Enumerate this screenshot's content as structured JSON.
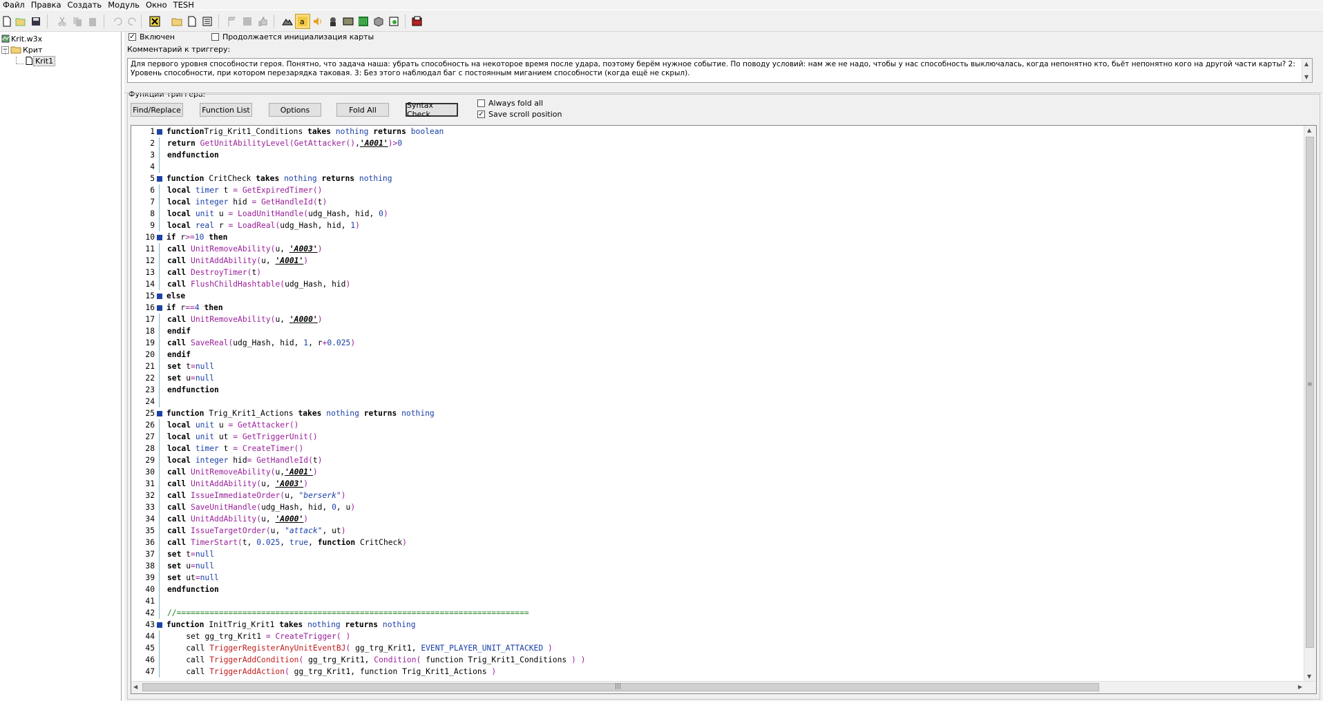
{
  "menu": [
    "Файл",
    "Правка",
    "Создать",
    "Модуль",
    "Окно",
    "TESH"
  ],
  "toolbar_icons": [
    "new-icon",
    "open-icon",
    "save-icon",
    "cut-icon",
    "copy-icon",
    "paste-icon",
    "undo-icon",
    "redo-icon",
    "delete-icon",
    "folder-icon",
    "page-icon",
    "list-icon",
    "flag-icon",
    "disk-icon",
    "thumb-icon",
    "terrain-icon",
    "letter-a-icon",
    "sound-icon",
    "unit-icon",
    "map-icon",
    "matrix-icon",
    "box-icon",
    "import-icon",
    "test-map-icon"
  ],
  "tree": {
    "root": "Krit.w3x",
    "category": "Крит",
    "trigger": "Krit1"
  },
  "panel": {
    "enabled_label": "Включен",
    "enabled_checked": true,
    "init_label": "Продолжается инициализация карты",
    "init_checked": false,
    "comment_label": "Комментарий к триггеру:",
    "comment_text": "Для первого уровня способности героя. Понятно, что задача наша: убрать способность на некоторое время после удара, поэтому берём нужное событие. По поводу условий: нам же не надо, чтобы у нас способность выключалась, когда непонятно кто, бьёт непонятно кого на другой части карты? 2: Уровень способности, при котором перезарядка таковая. 3: Без этого наблюдал баг с постоянным миганием способности (когда ещё не скрыл).",
    "functions_label": "Функции триггера:",
    "buttons": {
      "find_replace": "Find/Replace",
      "function_list": "Function List",
      "options": "Options",
      "fold_all": "Fold All",
      "syntax_check": "Syntax Check"
    },
    "always_fold_label": "Always fold all",
    "always_fold_checked": false,
    "save_scroll_label": "Save scroll position",
    "save_scroll_checked": true
  },
  "colors": {
    "fold_marker": "#1c43a6",
    "keyword_type": "#1a3fa8",
    "native_function": "#9a1e9a",
    "bj_function": "#c11b1b"
  },
  "code_lines": [
    {
      "n": 1,
      "fold": true,
      "tokens": [
        [
          "kw",
          "function"
        ],
        [
          "",
          "Trig_Krit1_Conditions "
        ],
        [
          "kw",
          "takes"
        ],
        [
          "",
          ""
        ],
        [
          "ty",
          " nothing"
        ],
        [
          "",
          ""
        ],
        [
          "kw",
          " returns"
        ],
        [
          "ty",
          " boolean"
        ]
      ]
    },
    {
      "n": 2,
      "tokens": [
        [
          "kw",
          "return"
        ],
        [
          "fn",
          " GetUnitAbilityLevel"
        ],
        [
          "op",
          "("
        ],
        [
          "fn",
          "GetAttacker"
        ],
        [
          "op",
          "()"
        ],
        [
          "",
          ","
        ],
        [
          "raw",
          "'A001'"
        ],
        [
          "op",
          ")>"
        ],
        [
          "num",
          "0"
        ]
      ]
    },
    {
      "n": 3,
      "tokens": [
        [
          "kw",
          "endfunction"
        ]
      ]
    },
    {
      "n": 4,
      "tokens": []
    },
    {
      "n": 5,
      "fold": true,
      "tokens": [
        [
          "kw",
          "function"
        ],
        [
          "",
          " CritCheck "
        ],
        [
          "kw",
          "takes"
        ],
        [
          "ty",
          " nothing"
        ],
        [
          "kw",
          " returns"
        ],
        [
          "ty",
          " nothing"
        ]
      ]
    },
    {
      "n": 6,
      "tokens": [
        [
          "kw",
          "local"
        ],
        [
          "ty",
          " timer"
        ],
        [
          "",
          " t "
        ],
        [
          "op",
          "="
        ],
        [
          "fn",
          " GetExpiredTimer"
        ],
        [
          "op",
          "()"
        ]
      ]
    },
    {
      "n": 7,
      "tokens": [
        [
          "kw",
          "local"
        ],
        [
          "ty",
          " integer"
        ],
        [
          "",
          " hid "
        ],
        [
          "op",
          "="
        ],
        [
          "fn",
          " GetHandleId"
        ],
        [
          "op",
          "("
        ],
        [
          "",
          "t"
        ],
        [
          "op",
          ")"
        ]
      ]
    },
    {
      "n": 8,
      "tokens": [
        [
          "kw",
          "local"
        ],
        [
          "ty",
          " unit"
        ],
        [
          "",
          " u "
        ],
        [
          "op",
          "="
        ],
        [
          "fn",
          " LoadUnitHandle"
        ],
        [
          "op",
          "("
        ],
        [
          "",
          "udg_Hash, hid, "
        ],
        [
          "num",
          "0"
        ],
        [
          "op",
          ")"
        ]
      ]
    },
    {
      "n": 9,
      "tokens": [
        [
          "kw",
          "local"
        ],
        [
          "ty",
          " real"
        ],
        [
          "",
          " r "
        ],
        [
          "op",
          "="
        ],
        [
          "fn",
          " LoadReal"
        ],
        [
          "op",
          "("
        ],
        [
          "",
          "udg_Hash, hid, "
        ],
        [
          "num",
          "1"
        ],
        [
          "op",
          ")"
        ]
      ]
    },
    {
      "n": 10,
      "fold": true,
      "tokens": [
        [
          "kw",
          "if"
        ],
        [
          "",
          " r"
        ],
        [
          "op",
          ">="
        ],
        [
          "num",
          "10"
        ],
        [
          "kw",
          " then"
        ]
      ]
    },
    {
      "n": 11,
      "tokens": [
        [
          "kw",
          "call"
        ],
        [
          "fn",
          " UnitRemoveAbility"
        ],
        [
          "op",
          "("
        ],
        [
          "",
          "u, "
        ],
        [
          "raw",
          "'A003'"
        ],
        [
          "op",
          ")"
        ]
      ]
    },
    {
      "n": 12,
      "tokens": [
        [
          "kw",
          "call"
        ],
        [
          "fn",
          " UnitAddAbility"
        ],
        [
          "op",
          "("
        ],
        [
          "",
          "u, "
        ],
        [
          "raw",
          "'A001'"
        ],
        [
          "op",
          ")"
        ]
      ]
    },
    {
      "n": 13,
      "tokens": [
        [
          "kw",
          "call"
        ],
        [
          "fn",
          " DestroyTimer"
        ],
        [
          "op",
          "("
        ],
        [
          "",
          "t"
        ],
        [
          "op",
          ")"
        ]
      ]
    },
    {
      "n": 14,
      "tokens": [
        [
          "kw",
          "call"
        ],
        [
          "fn",
          " FlushChildHashtable"
        ],
        [
          "op",
          "("
        ],
        [
          "",
          "udg_Hash, hid"
        ],
        [
          "op",
          ")"
        ]
      ]
    },
    {
      "n": 15,
      "fold": true,
      "tokens": [
        [
          "kw",
          "else"
        ]
      ]
    },
    {
      "n": 16,
      "fold": true,
      "tokens": [
        [
          "kw",
          "if"
        ],
        [
          "",
          " r"
        ],
        [
          "op",
          "=="
        ],
        [
          "num",
          "4"
        ],
        [
          "kw",
          " then"
        ]
      ]
    },
    {
      "n": 17,
      "tokens": [
        [
          "kw",
          "call"
        ],
        [
          "fn",
          " UnitRemoveAbility"
        ],
        [
          "op",
          "("
        ],
        [
          "",
          "u, "
        ],
        [
          "raw",
          "'A000'"
        ],
        [
          "op",
          ")"
        ]
      ]
    },
    {
      "n": 18,
      "tokens": [
        [
          "kw",
          "endif"
        ]
      ]
    },
    {
      "n": 19,
      "tokens": [
        [
          "kw",
          "call"
        ],
        [
          "fn",
          " SaveReal"
        ],
        [
          "op",
          "("
        ],
        [
          "",
          "udg_Hash, hid, "
        ],
        [
          "num",
          "1"
        ],
        [
          "",
          ", r"
        ],
        [
          "op",
          "+"
        ],
        [
          "num",
          "0.025"
        ],
        [
          "op",
          ")"
        ]
      ]
    },
    {
      "n": 20,
      "tokens": [
        [
          "kw",
          "endif"
        ]
      ]
    },
    {
      "n": 21,
      "tokens": [
        [
          "kw",
          "set"
        ],
        [
          "",
          " t"
        ],
        [
          "op",
          "="
        ],
        [
          "ty",
          "null"
        ]
      ]
    },
    {
      "n": 22,
      "tokens": [
        [
          "kw",
          "set"
        ],
        [
          "",
          " u"
        ],
        [
          "op",
          "="
        ],
        [
          "ty",
          "null"
        ]
      ]
    },
    {
      "n": 23,
      "tokens": [
        [
          "kw",
          "endfunction"
        ]
      ]
    },
    {
      "n": 24,
      "tokens": []
    },
    {
      "n": 25,
      "fold": true,
      "tokens": [
        [
          "kw",
          "function"
        ],
        [
          "",
          " Trig_Krit1_Actions "
        ],
        [
          "kw",
          "takes"
        ],
        [
          "ty",
          " nothing"
        ],
        [
          "kw",
          " returns"
        ],
        [
          "ty",
          " nothing"
        ]
      ]
    },
    {
      "n": 26,
      "tokens": [
        [
          "kw",
          "local"
        ],
        [
          "ty",
          " unit"
        ],
        [
          "",
          " u "
        ],
        [
          "op",
          "="
        ],
        [
          "fn",
          " GetAttacker"
        ],
        [
          "op",
          "()"
        ]
      ]
    },
    {
      "n": 27,
      "tokens": [
        [
          "kw",
          "local"
        ],
        [
          "ty",
          " unit"
        ],
        [
          "",
          " ut "
        ],
        [
          "op",
          "="
        ],
        [
          "fn",
          " GetTriggerUnit"
        ],
        [
          "op",
          "()"
        ]
      ]
    },
    {
      "n": 28,
      "tokens": [
        [
          "kw",
          "local"
        ],
        [
          "ty",
          " timer"
        ],
        [
          "",
          " t "
        ],
        [
          "op",
          "="
        ],
        [
          "fn",
          " CreateTimer"
        ],
        [
          "op",
          "()"
        ]
      ]
    },
    {
      "n": 29,
      "tokens": [
        [
          "kw",
          "local"
        ],
        [
          "ty",
          " integer"
        ],
        [
          "",
          " hid"
        ],
        [
          "op",
          "="
        ],
        [
          "fn",
          " GetHandleId"
        ],
        [
          "op",
          "("
        ],
        [
          "",
          "t"
        ],
        [
          "op",
          ")"
        ]
      ]
    },
    {
      "n": 30,
      "tokens": [
        [
          "kw",
          "call"
        ],
        [
          "fn",
          " UnitRemoveAbility"
        ],
        [
          "op",
          "("
        ],
        [
          "",
          "u,"
        ],
        [
          "raw",
          "'A001'"
        ],
        [
          "op",
          ")"
        ]
      ]
    },
    {
      "n": 31,
      "tokens": [
        [
          "kw",
          "call"
        ],
        [
          "fn",
          " UnitAddAbility"
        ],
        [
          "op",
          "("
        ],
        [
          "",
          "u, "
        ],
        [
          "raw",
          "'A003'"
        ],
        [
          "op",
          ")"
        ]
      ]
    },
    {
      "n": 32,
      "tokens": [
        [
          "kw",
          "call"
        ],
        [
          "fn",
          " IssueImmediateOrder"
        ],
        [
          "op",
          "("
        ],
        [
          "",
          "u, "
        ],
        [
          "str",
          "\"berserk\""
        ],
        [
          "op",
          ")"
        ]
      ]
    },
    {
      "n": 33,
      "tokens": [
        [
          "kw",
          "call"
        ],
        [
          "fn",
          " SaveUnitHandle"
        ],
        [
          "op",
          "("
        ],
        [
          "",
          "udg_Hash, hid, "
        ],
        [
          "num",
          "0"
        ],
        [
          "",
          ", u"
        ],
        [
          "op",
          ")"
        ]
      ]
    },
    {
      "n": 34,
      "tokens": [
        [
          "kw",
          "call"
        ],
        [
          "fn",
          " UnitAddAbility"
        ],
        [
          "op",
          "("
        ],
        [
          "",
          "u, "
        ],
        [
          "raw",
          "'A000'"
        ],
        [
          "op",
          ")"
        ]
      ]
    },
    {
      "n": 35,
      "tokens": [
        [
          "kw",
          "call"
        ],
        [
          "fn",
          " IssueTargetOrder"
        ],
        [
          "op",
          "("
        ],
        [
          "",
          "u, "
        ],
        [
          "str",
          "\"attack\""
        ],
        [
          "",
          ", ut"
        ],
        [
          "op",
          ")"
        ]
      ]
    },
    {
      "n": 36,
      "tokens": [
        [
          "kw",
          "call"
        ],
        [
          "fn",
          " TimerStart"
        ],
        [
          "op",
          "("
        ],
        [
          "",
          "t, "
        ],
        [
          "num",
          "0.025"
        ],
        [
          "",
          ", "
        ],
        [
          "ty",
          "true"
        ],
        [
          "",
          ", "
        ],
        [
          "kw",
          "function"
        ],
        [
          "",
          " CritCheck"
        ],
        [
          "op",
          ")"
        ]
      ]
    },
    {
      "n": 37,
      "tokens": [
        [
          "kw",
          "set"
        ],
        [
          "",
          " t"
        ],
        [
          "op",
          "="
        ],
        [
          "ty",
          "null"
        ]
      ]
    },
    {
      "n": 38,
      "tokens": [
        [
          "kw",
          "set"
        ],
        [
          "",
          " u"
        ],
        [
          "op",
          "="
        ],
        [
          "ty",
          "null"
        ]
      ]
    },
    {
      "n": 39,
      "tokens": [
        [
          "kw",
          "set"
        ],
        [
          "",
          " ut"
        ],
        [
          "op",
          "="
        ],
        [
          "ty",
          "null"
        ]
      ]
    },
    {
      "n": 40,
      "tokens": [
        [
          "kw",
          "endfunction"
        ]
      ]
    },
    {
      "n": 41,
      "tokens": []
    },
    {
      "n": 42,
      "tokens": [
        [
          "cmt",
          "//==========================================================================="
        ]
      ]
    },
    {
      "n": 43,
      "fold": true,
      "tokens": [
        [
          "kw",
          "function"
        ],
        [
          "",
          " InitTrig_Krit1 "
        ],
        [
          "kw",
          "takes"
        ],
        [
          "ty",
          " nothing"
        ],
        [
          "kw",
          " returns"
        ],
        [
          "ty",
          " nothing"
        ]
      ]
    },
    {
      "n": 44,
      "tokens": [
        [
          "",
          "    set gg_trg_Krit1 "
        ],
        [
          "op",
          "="
        ],
        [
          "fn",
          " CreateTrigger"
        ],
        [
          "op",
          "( )"
        ]
      ]
    },
    {
      "n": 45,
      "tokens": [
        [
          "",
          "    call "
        ],
        [
          "bfn",
          "TriggerRegisterAnyUnitEventBJ"
        ],
        [
          "op",
          "("
        ],
        [
          "",
          " gg_trg_Krit1, "
        ],
        [
          "cst",
          "EVENT_PLAYER_UNIT_ATTACKED"
        ],
        [
          "op",
          " )"
        ]
      ]
    },
    {
      "n": 46,
      "tokens": [
        [
          "",
          "    call "
        ],
        [
          "bfn",
          "TriggerAddCondition"
        ],
        [
          "op",
          "("
        ],
        [
          "",
          " gg_trg_Krit1, "
        ],
        [
          "fn",
          "Condition"
        ],
        [
          "op",
          "("
        ],
        [
          "",
          " function Trig_Krit1_Conditions "
        ],
        [
          "op",
          ") )"
        ]
      ]
    },
    {
      "n": 47,
      "tokens": [
        [
          "",
          "    call "
        ],
        [
          "bfn",
          "TriggerAddAction"
        ],
        [
          "op",
          "("
        ],
        [
          "",
          " gg_trg_Krit1, function Trig_Krit1_Actions "
        ],
        [
          "op",
          ")"
        ]
      ]
    }
  ]
}
